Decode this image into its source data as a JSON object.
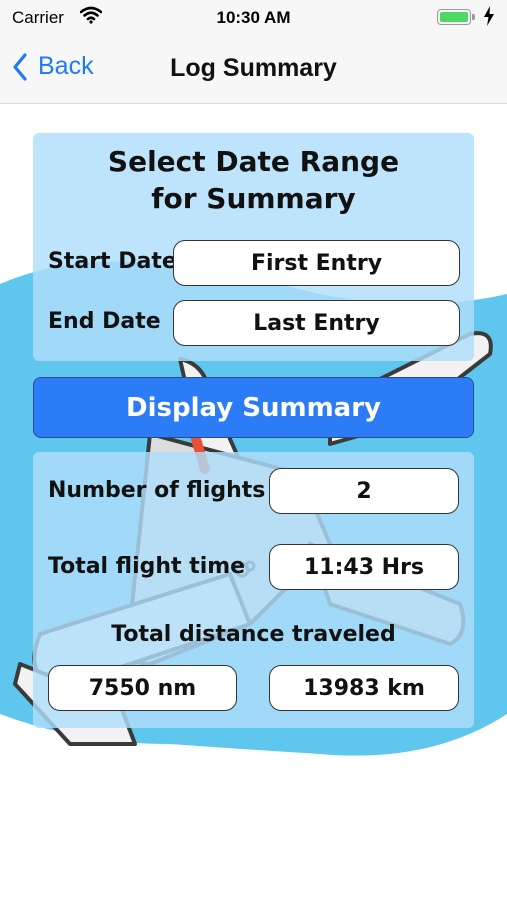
{
  "status": {
    "carrier": "Carrier",
    "time": "10:30 AM"
  },
  "nav": {
    "back_label": "Back",
    "title": "Log Summary"
  },
  "range": {
    "title_line1": "Select Date Range",
    "title_line2": "for Summary",
    "start_label": "Start Date",
    "start_value": "First Entry",
    "end_label": "End Date",
    "end_value": "Last Entry"
  },
  "display_button": "Display Summary",
  "summary": {
    "flights_label": "Number of flights",
    "flights_value": "2",
    "time_label": "Total flight time",
    "time_value": "11:43 Hrs",
    "distance_label": "Total distance traveled",
    "distance_nm": "7550 nm",
    "distance_km": "13983 km"
  },
  "colors": {
    "accent": "#1b7cf5",
    "button": "#2d7cf7",
    "panel": "#aedefa",
    "wave": "#5fc6ee"
  },
  "icons": [
    "wifi-icon",
    "battery-icon",
    "charging-icon",
    "chevron-left-icon",
    "airplane-background-icon"
  ]
}
